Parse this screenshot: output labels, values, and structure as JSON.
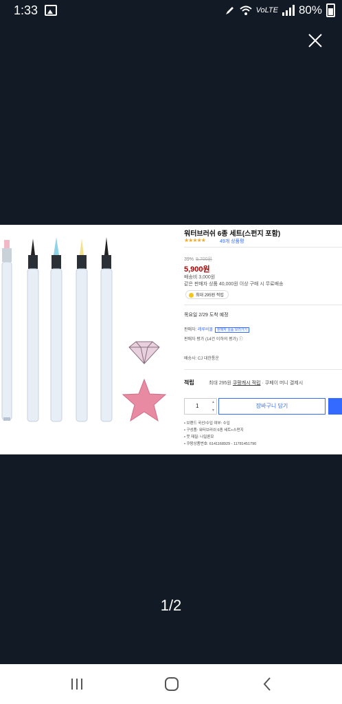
{
  "status_bar": {
    "time": "1:33",
    "network": "VoLTE",
    "battery": "80%"
  },
  "viewer": {
    "counter": "1/2"
  },
  "product": {
    "title": "워터브러쉬 6종 세트(스펀지 포함)",
    "stars": "★★★★★",
    "rating_value": 4.5,
    "reviews": "49개 상품평",
    "discount": "39%",
    "original_price": "9,700원",
    "price": "5,900원",
    "shipping": "배송비 3,000원",
    "free_shipping": "같은 판매자 상품 40,000원 이상 구매 시 무료배송",
    "points_badge": "최대 295원 적립",
    "arrival": "목요일 2/29 도착 예정",
    "seller_label": "판매자:",
    "seller_name": "레루비몰",
    "seller_tag": "판매자 상품 보러가기",
    "seller_rating_label": "판매자 평가",
    "seller_rating_note": "(14건 이하의 평가)",
    "delivery": "배송사: CJ 대한통운",
    "points_label": "적립",
    "points_text": "최대 295원",
    "points_link": "쿠팡캐시 적립",
    "points_suffix": "· 쿠페이 머니 결제시",
    "quantity": "1",
    "cart_button": "장바구니 담기",
    "bullets": [
      "브랜드 국산/수입 여부: 수입",
      "구성품: 워터브러쉬 6종 세트+스펀지",
      "붓 재질: 나일론모",
      "쿠팡상품번호: 6141168929 - 11781451790"
    ]
  },
  "colors": {
    "background": "#121a26",
    "accent": "#346aff",
    "price": "#ae0000"
  }
}
